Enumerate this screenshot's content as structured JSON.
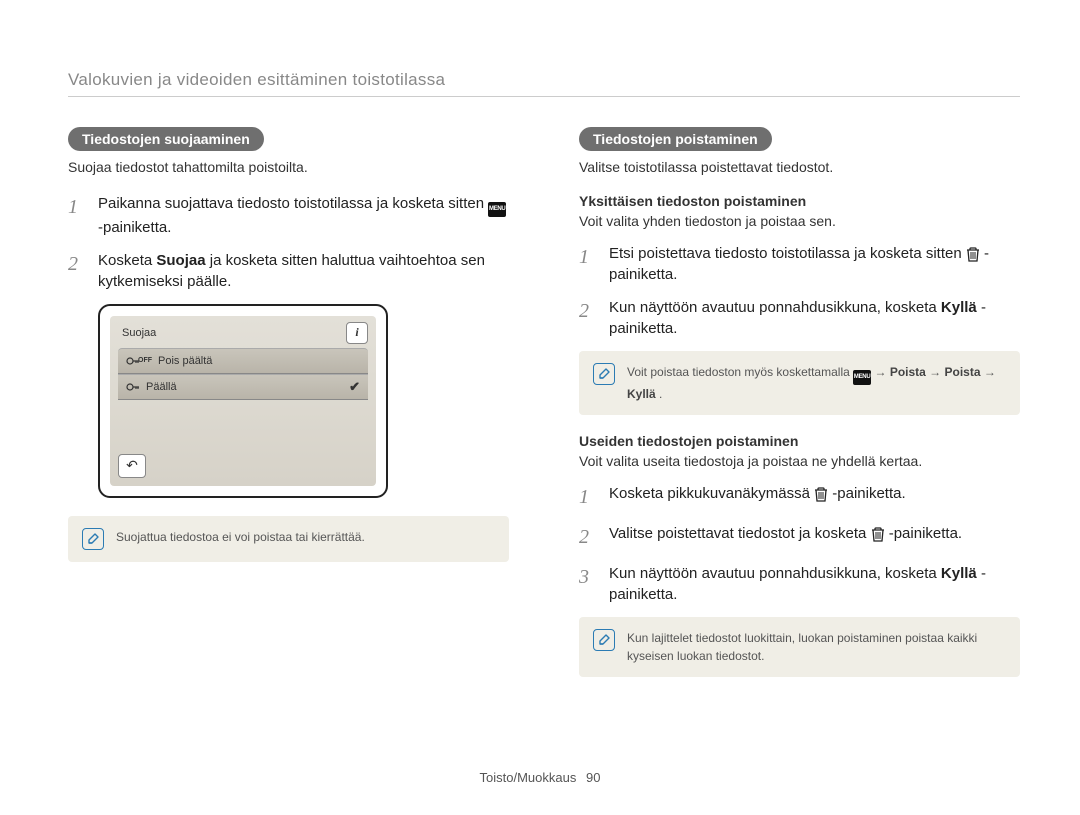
{
  "header": {
    "title": "Valokuvien ja videoiden esittäminen toistotilassa"
  },
  "left": {
    "pill": "Tiedostojen suojaaminen",
    "lead": "Suojaa tiedostot tahattomilta poistoilta.",
    "step1_a": "Paikanna suojattava tiedosto toistotilassa ja kosketa sitten ",
    "step1_menu": "MENU",
    "step1_b": " -painiketta.",
    "step2_a": "Kosketa ",
    "step2_bold": "Suojaa",
    "step2_b": " ja kosketa sitten haluttua vaihtoehtoa sen kytkemiseksi päälle.",
    "device": {
      "title": "Suojaa",
      "row1": "Pois päältä",
      "row2": "Päällä"
    },
    "note": "Suojattua tiedostoa ei voi poistaa tai kierrättää."
  },
  "right": {
    "pill": "Tiedostojen poistaminen",
    "lead": "Valitse toistotilassa poistettavat tiedostot.",
    "sub1_head": "Yksittäisen tiedoston poistaminen",
    "sub1_desc": "Voit valita yhden tiedoston ja poistaa sen.",
    "s1_1_a": "Etsi poistettava tiedosto toistotilassa ja kosketa sitten ",
    "s1_1_b": " -painiketta.",
    "s1_2_a": "Kun näyttöön avautuu ponnahdusikkuna, kosketa ",
    "s1_2_bold": "Kyllä",
    "s1_2_b": "-painiketta.",
    "note1_a": "Voit poistaa tiedoston myös koskettamalla ",
    "note1_menu": "MENU",
    "note1_b": " → ",
    "note1_bold1": "Poista",
    "note1_c": " → ",
    "note1_bold2": "Poista",
    "note1_d": " → ",
    "note1_bold3": "Kyllä",
    "note1_e": ".",
    "sub2_head": "Useiden tiedostojen poistaminen",
    "sub2_desc": "Voit valita useita tiedostoja ja poistaa ne yhdellä kertaa.",
    "s2_1_a": "Kosketa pikkukuvanäkymässä ",
    "s2_1_b": "-painiketta.",
    "s2_2_a": "Valitse poistettavat tiedostot ja kosketa ",
    "s2_2_b": "-painiketta.",
    "s2_3_a": "Kun näyttöön avautuu ponnahdusikkuna, kosketa ",
    "s2_3_bold": "Kyllä",
    "s2_3_b": "-painiketta.",
    "note2": "Kun lajittelet tiedostot luokittain, luokan poistaminen poistaa kaikki kyseisen luokan tiedostot."
  },
  "footer": {
    "section": "Toisto/Muokkaus",
    "page": "90"
  }
}
